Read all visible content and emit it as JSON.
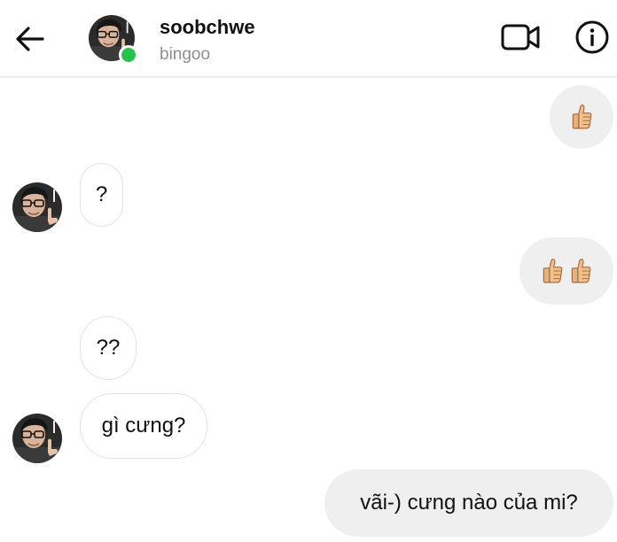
{
  "header": {
    "username": "soobchwe",
    "subtitle": "bingoo",
    "back_icon": "arrow-left-icon",
    "video_icon": "video-camera-icon",
    "info_icon": "info-icon",
    "online_color": "#27c24c"
  },
  "messages": [
    {
      "sender": "me",
      "type": "emoji",
      "icon": "thumbs-up-icon",
      "count": 1
    },
    {
      "sender": "them",
      "type": "text",
      "text": "?"
    },
    {
      "sender": "me",
      "type": "emoji",
      "icon": "thumbs-up-icon",
      "count": 2
    },
    {
      "sender": "them",
      "type": "text",
      "text": "??"
    },
    {
      "sender": "them",
      "type": "text",
      "text": "gì cưng?"
    },
    {
      "sender": "me",
      "type": "text",
      "text": "vãi-) cưng nào của mi?"
    }
  ],
  "colors": {
    "incoming_bubble_bg": "#ffffff",
    "incoming_bubble_border": "#e3e3e3",
    "outgoing_bubble_bg": "#efefef",
    "muted_text": "#8e8e8e"
  }
}
